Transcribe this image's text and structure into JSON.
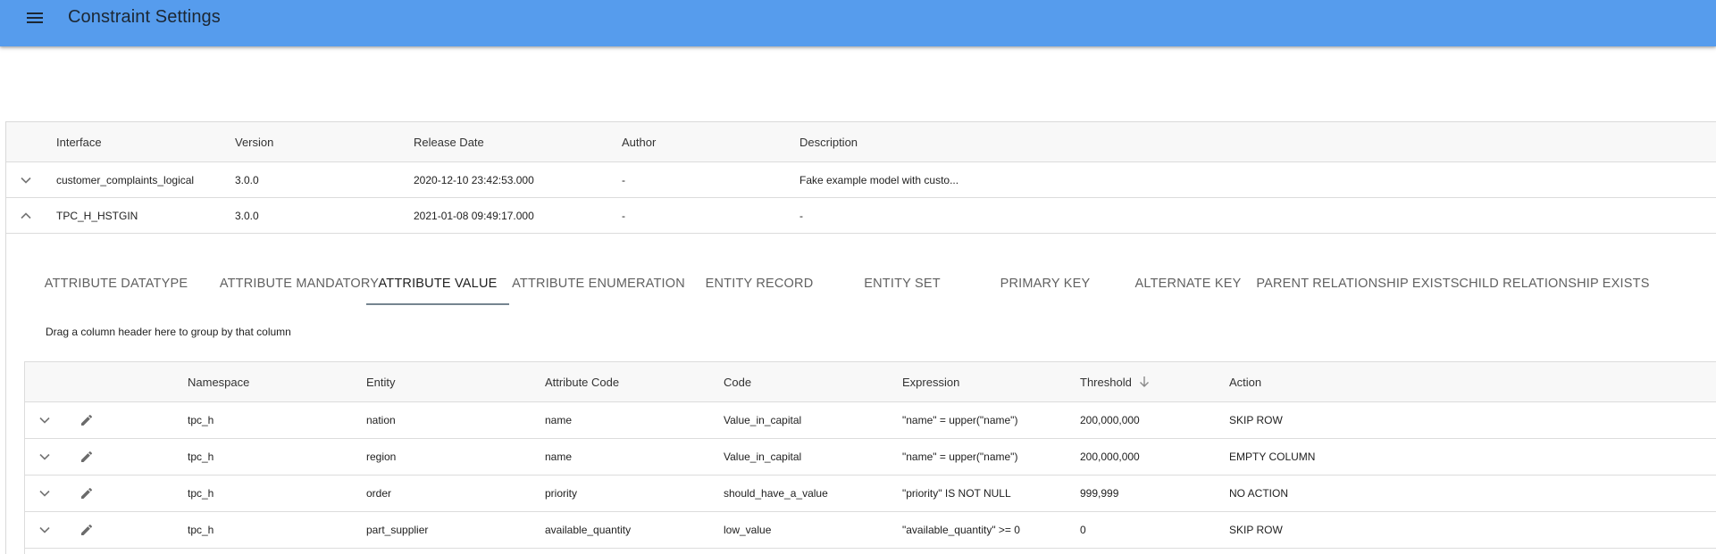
{
  "app": {
    "title": "Constraint Settings",
    "menu_icon": "menu-icon",
    "brand_color": "#569ced"
  },
  "interfaces": {
    "columns": [
      "Interface",
      "Version",
      "Release Date",
      "Author",
      "Description"
    ],
    "rows": [
      {
        "expanded": false,
        "toggle_icon": "chevron-down-icon",
        "interface": "customer_complaints_logical",
        "version": "3.0.0",
        "release_date": "2020-12-10 23:42:53.000",
        "author": "-",
        "description": "Fake example model with custo..."
      },
      {
        "expanded": true,
        "toggle_icon": "chevron-up-icon",
        "interface": "TPC_H_HSTGIN",
        "version": "3.0.0",
        "release_date": "2021-01-08 09:49:17.000",
        "author": "-",
        "description": "-"
      }
    ]
  },
  "tabs": {
    "active_index": 2,
    "items": [
      {
        "label": "ATTRIBUTE DATATYPE"
      },
      {
        "label": "ATTRIBUTE MANDATORY"
      },
      {
        "label": "ATTRIBUTE VALUE"
      },
      {
        "label": "ATTRIBUTE ENUMERATION"
      },
      {
        "label": "ENTITY RECORD"
      },
      {
        "label": "ENTITY SET"
      },
      {
        "label": "PRIMARY KEY"
      },
      {
        "label": "ALTERNATE KEY"
      },
      {
        "label": "PARENT RELATIONSHIP EXISTS"
      },
      {
        "label": "CHILD RELATIONSHIP EXISTS"
      }
    ]
  },
  "grid": {
    "group_hint": "Drag a column header here to group by that column",
    "columns": [
      "Namespace",
      "Entity",
      "Attribute Code",
      "Code",
      "Expression",
      "Threshold",
      "Action"
    ],
    "sort": {
      "column": "Threshold",
      "direction": "descending",
      "icon": "arrow-down-icon"
    },
    "row_icons": {
      "expand": "chevron-down-icon",
      "edit": "pencil-icon"
    },
    "rows": [
      {
        "namespace": "tpc_h",
        "entity": "nation",
        "attribute_code": "name",
        "code": "Value_in_capital",
        "expression": "\"name\" = upper(\"name\")",
        "threshold": "200,000,000",
        "action": "SKIP ROW"
      },
      {
        "namespace": "tpc_h",
        "entity": "region",
        "attribute_code": "name",
        "code": "Value_in_capital",
        "expression": "\"name\" = upper(\"name\")",
        "threshold": "200,000,000",
        "action": "EMPTY COLUMN"
      },
      {
        "namespace": "tpc_h",
        "entity": "order",
        "attribute_code": "priority",
        "code": "should_have_a_value",
        "expression": "\"priority\" IS NOT NULL",
        "threshold": "999,999",
        "action": "NO ACTION"
      },
      {
        "namespace": "tpc_h",
        "entity": "part_supplier",
        "attribute_code": "available_quantity",
        "code": "low_value",
        "expression": "\"available_quantity\" >= 0",
        "threshold": "0",
        "action": "SKIP ROW"
      }
    ]
  }
}
